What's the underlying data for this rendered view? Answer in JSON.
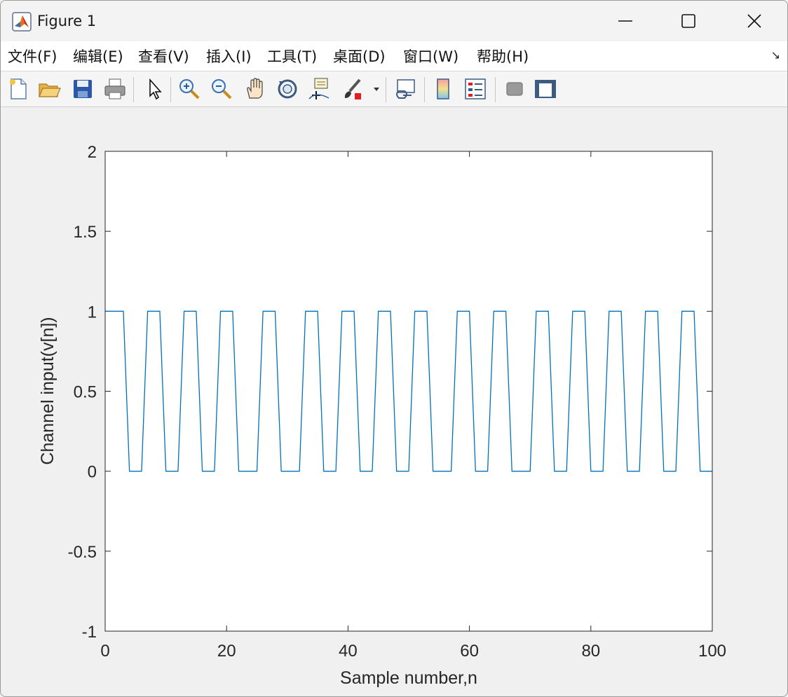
{
  "window": {
    "title": "Figure 1",
    "menu": [
      "文件(F)",
      "编辑(E)",
      "查看(V)",
      "插入(I)",
      "工具(T)",
      "桌面(D)",
      "窗口(W)",
      "帮助(H)"
    ],
    "menu_corner_icon": "dock-arrow-icon",
    "toolbar_icons": [
      "new-figure-icon",
      "open-file-icon",
      "save-icon",
      "print-icon",
      "select-arrow-icon",
      "zoom-in-icon",
      "zoom-out-icon",
      "pan-hand-icon",
      "rotate-3d-icon",
      "data-cursor-icon",
      "brush-icon",
      "link-plot-icon",
      "colorbar-icon",
      "legend-icon",
      "hide-plot-tools-icon",
      "show-plot-tools-icon"
    ]
  },
  "chart_data": {
    "type": "line",
    "xlabel": "Sample number,n",
    "ylabel": "Channel input(v[n])",
    "xlim": [
      0,
      100
    ],
    "ylim": [
      -1,
      2
    ],
    "x_ticks": [
      "0",
      "20",
      "40",
      "60",
      "80",
      "100"
    ],
    "y_ticks": [
      "2",
      "1.5",
      "1",
      "0.5",
      "0",
      "-0.5",
      "-1"
    ],
    "grid": false,
    "line_color": "#0072bd",
    "series": [
      {
        "x": [
          0,
          3,
          4,
          6,
          7,
          9,
          10,
          12,
          13,
          15,
          16,
          18,
          19,
          21,
          22,
          25,
          26,
          28,
          29,
          32,
          33,
          35,
          36,
          38,
          39,
          41,
          42,
          44,
          45,
          47,
          48,
          50,
          51,
          53,
          54,
          57,
          58,
          60,
          61,
          63,
          64,
          66,
          67,
          70,
          71,
          73,
          74,
          76,
          77,
          79,
          80,
          82,
          83,
          85,
          86,
          88,
          89,
          91,
          92,
          94,
          95,
          97,
          98,
          100
        ],
        "y": [
          1,
          1,
          0,
          0,
          1,
          1,
          0,
          0,
          1,
          1,
          0,
          0,
          1,
          1,
          0,
          0,
          1,
          1,
          0,
          0,
          1,
          1,
          0,
          0,
          1,
          1,
          0,
          0,
          1,
          1,
          0,
          0,
          1,
          1,
          0,
          0,
          1,
          1,
          0,
          0,
          1,
          1,
          0,
          0,
          1,
          1,
          0,
          0,
          1,
          1,
          0,
          0,
          1,
          1,
          0,
          0,
          1,
          1,
          0,
          0,
          1,
          1,
          0,
          0
        ]
      }
    ]
  }
}
